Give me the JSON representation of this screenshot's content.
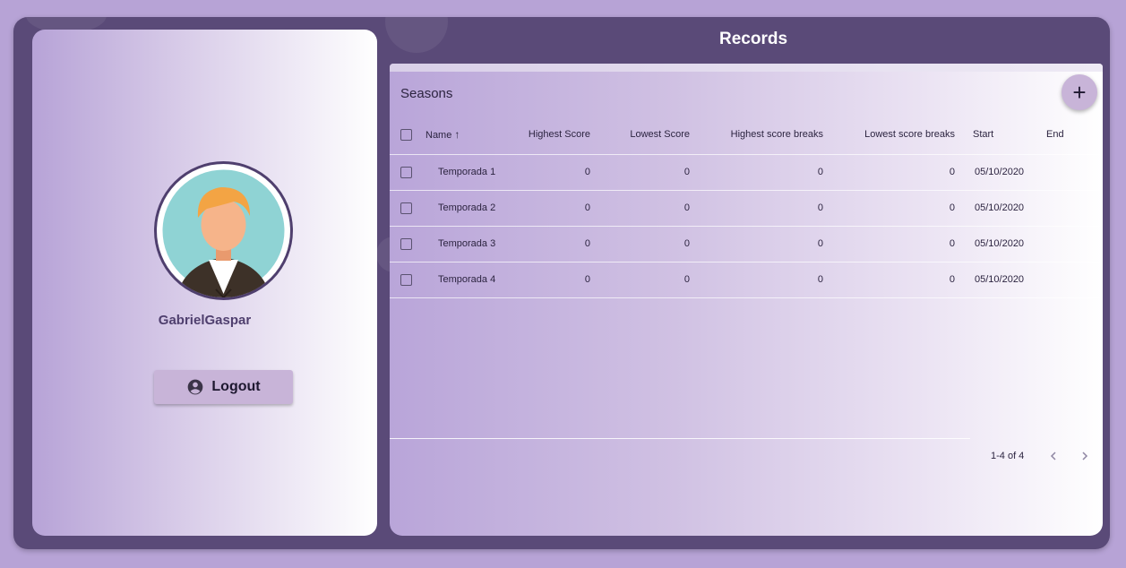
{
  "profile": {
    "username": "GabrielGaspar",
    "logout_label": "Logout"
  },
  "page": {
    "title": "Records"
  },
  "seasons": {
    "title": "Seasons",
    "add_label": "+",
    "columns": [
      "Name",
      "Highest Score",
      "Lowest Score",
      "Highest score breaks",
      "Lowest score breaks",
      "Start",
      "End"
    ],
    "rows": [
      {
        "name": "Temporada 1",
        "highest": "0",
        "lowest": "0",
        "highest_breaks": "0",
        "lowest_breaks": "0",
        "start": "05/10/2020",
        "end": ""
      },
      {
        "name": "Temporada 2",
        "highest": "0",
        "lowest": "0",
        "highest_breaks": "0",
        "lowest_breaks": "0",
        "start": "05/10/2020",
        "end": ""
      },
      {
        "name": "Temporada 3",
        "highest": "0",
        "lowest": "0",
        "highest_breaks": "0",
        "lowest_breaks": "0",
        "start": "05/10/2020",
        "end": ""
      },
      {
        "name": "Temporada 4",
        "highest": "0",
        "lowest": "0",
        "highest_breaks": "0",
        "lowest_breaks": "0",
        "start": "05/10/2020",
        "end": ""
      }
    ],
    "pagination": {
      "range": "1-4 of 4"
    }
  },
  "colors": {
    "background": "#b7a3d6",
    "frame": "#5a4a78",
    "accent": "#c8b4d8",
    "text_dark": "#2c2440",
    "username": "#4f3f6e"
  },
  "icons": {
    "logout": "account-circle-icon",
    "sort": "arrow-up-icon",
    "add": "plus-icon",
    "prev": "chevron-left-icon",
    "next": "chevron-right-icon"
  }
}
